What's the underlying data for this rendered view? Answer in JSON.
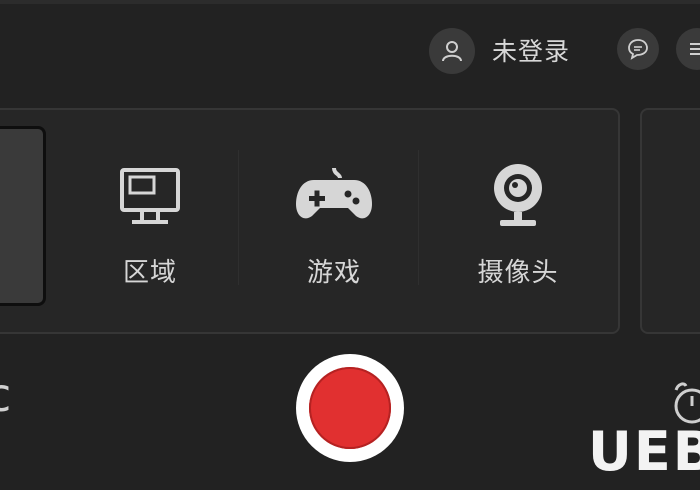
{
  "header": {
    "user": {
      "avatar_icon": "user-icon",
      "login_label": "未登录"
    },
    "buttons": [
      {
        "icon": "chat-icon"
      },
      {
        "icon": "menu-icon"
      }
    ]
  },
  "modes": [
    {
      "id": "fullscreen",
      "icon": "fullscreen-icon",
      "label": ""
    },
    {
      "id": "region",
      "icon": "monitor-icon",
      "label": "区域"
    },
    {
      "id": "game",
      "icon": "gamepad-icon",
      "label": "游戏"
    },
    {
      "id": "camera",
      "icon": "webcam-icon",
      "label": "摄像头"
    }
  ],
  "bottom": {
    "left_glyph": "c",
    "record_button": {
      "icon": "record-icon",
      "color": "#e13030"
    },
    "timer_icon": "alarm-clock-icon"
  },
  "watermark": "UEB",
  "colors": {
    "background": "#222222",
    "panel": "#262626",
    "accent_red": "#e13030"
  }
}
